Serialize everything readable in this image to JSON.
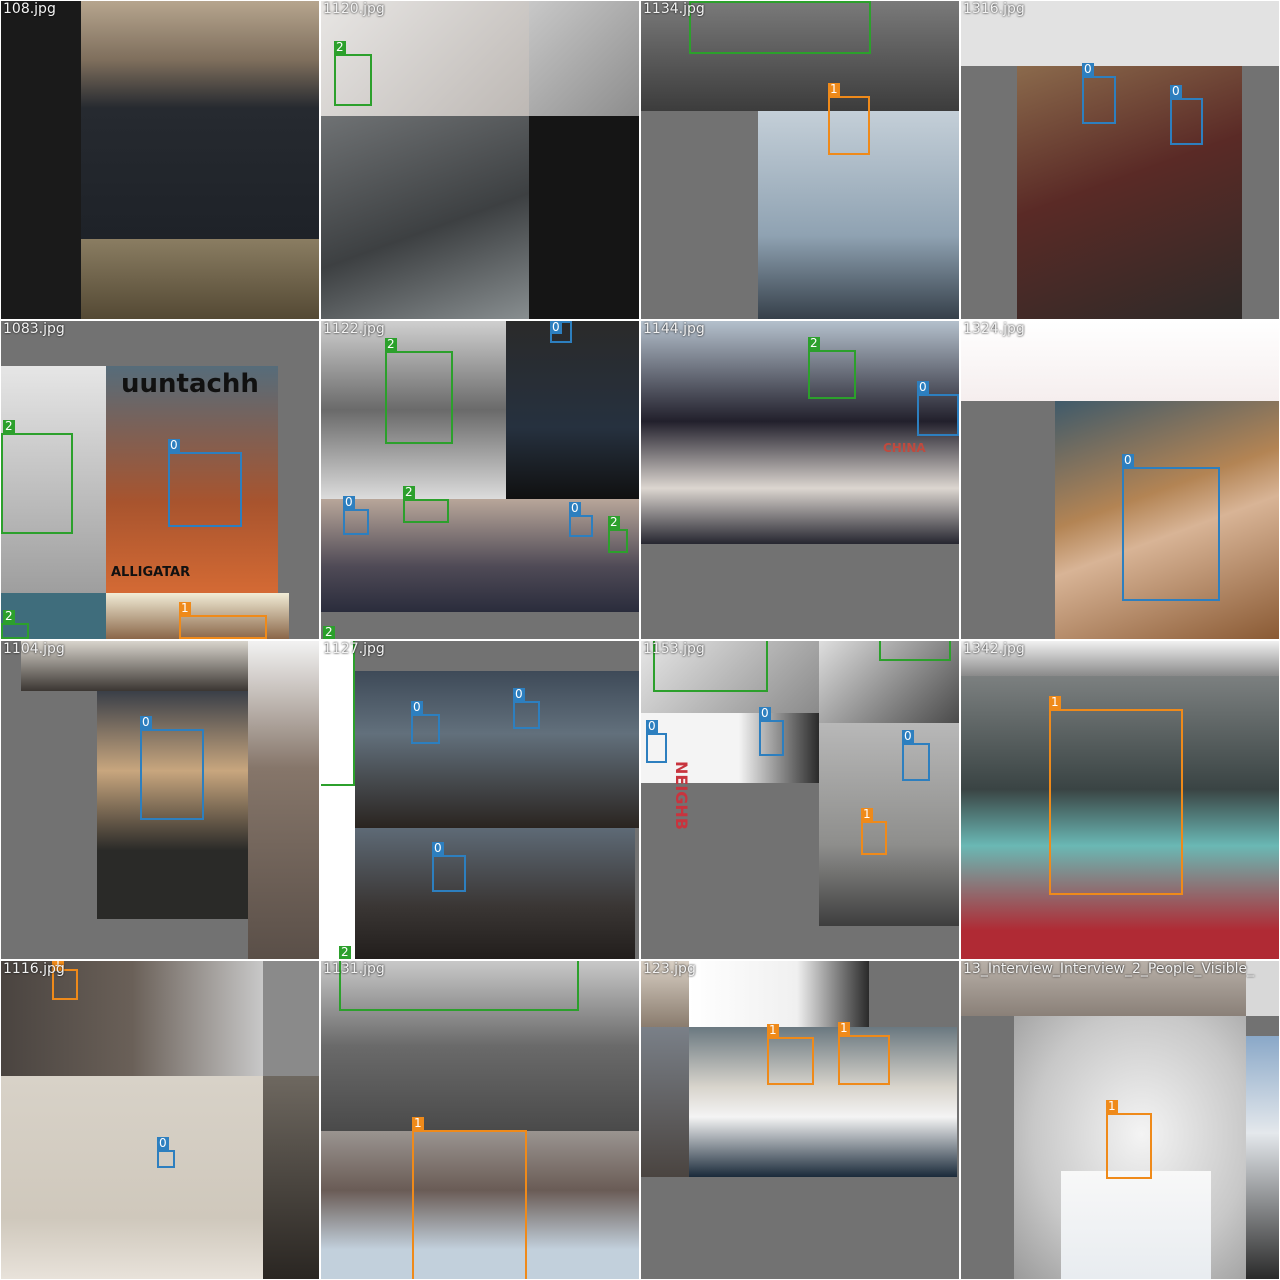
{
  "colors": {
    "class_0": "#2d7fbf",
    "class_1": "#ef8a1a",
    "class_2": "#2ca02c",
    "padding_gray": "#727272"
  },
  "tiles": [
    {
      "filename": "108.jpg"
    },
    {
      "filename": "1120.jpg"
    },
    {
      "filename": "1134.jpg"
    },
    {
      "filename": "1316.jpg"
    },
    {
      "filename": "1083.jpg",
      "texts": [
        "uuntachh",
        "ALLIGATAR"
      ]
    },
    {
      "filename": "1122.jpg"
    },
    {
      "filename": "1144.jpg",
      "texts": [
        "CHINA"
      ]
    },
    {
      "filename": "1324.jpg"
    },
    {
      "filename": "1104.jpg"
    },
    {
      "filename": "1127.jpg"
    },
    {
      "filename": "1153.jpg",
      "texts": [
        "NEIGHB"
      ]
    },
    {
      "filename": "1342.jpg"
    },
    {
      "filename": "1116.jpg"
    },
    {
      "filename": "1131.jpg"
    },
    {
      "filename": "123.jpg"
    },
    {
      "filename": "13_Interview_Interview_2_People_Visible_"
    }
  ],
  "class_labels": [
    "0",
    "1",
    "2"
  ]
}
